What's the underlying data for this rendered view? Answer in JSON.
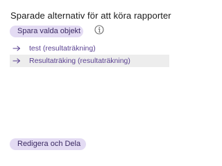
{
  "panel": {
    "title": "Sparade alternativ för att köra rapporter",
    "save_button_label": "Spara valda objekt",
    "info_icon": "info-icon",
    "items": [
      {
        "label": "test (resultaträkning)",
        "icon": "arrow-right-icon",
        "selected": false
      },
      {
        "label": "Resultaträking (resultaträkning)",
        "icon": "arrow-right-icon",
        "selected": true
      }
    ],
    "edit_button_label": "Redigera och Dela"
  },
  "colors": {
    "button_bg": "#e3dbf3",
    "button_text": "#3b2a63",
    "link_text": "#5a4191",
    "selected_row_bg": "#ededed"
  }
}
